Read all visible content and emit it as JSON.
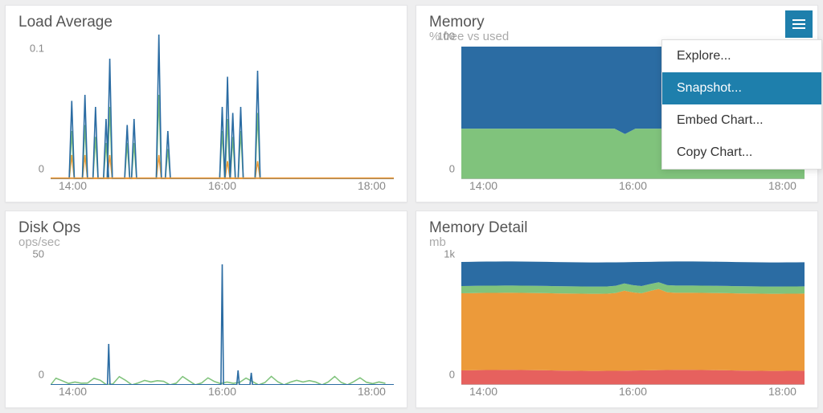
{
  "colors": {
    "blue": "#2b6ca3",
    "green": "#80c37c",
    "orange": "#ec9a3a",
    "red": "#e6615e",
    "accent": "#1e7fac"
  },
  "menu": {
    "items": [
      "Explore...",
      "Snapshot...",
      "Embed Chart...",
      "Copy Chart..."
    ],
    "selected_index": 1
  },
  "cards": {
    "load": {
      "title": "Load Average",
      "sub": "",
      "xticks": [
        "14:00",
        "16:00",
        "18:00"
      ],
      "yticks": [
        {
          "v": 0,
          "label": "0"
        },
        {
          "v": 0.1,
          "label": "0.1"
        }
      ]
    },
    "memory": {
      "title": "Memory",
      "sub": "% free vs used",
      "xticks": [
        "14:00",
        "16:00",
        "18:00"
      ],
      "yticks": [
        {
          "v": 0,
          "label": "0"
        },
        {
          "v": 100,
          "label": "100"
        }
      ]
    },
    "diskops": {
      "title": "Disk Ops",
      "sub": "ops/sec",
      "xticks": [
        "14:00",
        "16:00",
        "18:00"
      ],
      "yticks": [
        {
          "v": 0,
          "label": "0"
        },
        {
          "v": 50,
          "label": "50"
        }
      ]
    },
    "memdetail": {
      "title": "Memory Detail",
      "sub": "mb",
      "xticks": [
        "14:00",
        "16:00",
        "18:00"
      ],
      "yticks": [
        {
          "v": 0,
          "label": "0"
        },
        {
          "v": 1000,
          "label": "1k"
        }
      ]
    }
  },
  "chart_data": [
    {
      "id": "load",
      "type": "line",
      "title": "Load Average",
      "xlabel": "",
      "ylabel": "",
      "ylim": [
        0,
        0.12
      ],
      "x_range_hours": [
        12.5,
        19
      ],
      "series": [
        {
          "name": "load-blue",
          "color": "#2b6ca3",
          "spikes": [
            {
              "x": 12.9,
              "y": 0.065
            },
            {
              "x": 13.15,
              "y": 0.07
            },
            {
              "x": 13.35,
              "y": 0.06
            },
            {
              "x": 13.55,
              "y": 0.05
            },
            {
              "x": 13.62,
              "y": 0.1
            },
            {
              "x": 13.95,
              "y": 0.045
            },
            {
              "x": 14.08,
              "y": 0.05
            },
            {
              "x": 14.55,
              "y": 0.12
            },
            {
              "x": 14.72,
              "y": 0.04
            },
            {
              "x": 15.75,
              "y": 0.06
            },
            {
              "x": 15.85,
              "y": 0.085
            },
            {
              "x": 15.95,
              "y": 0.055
            },
            {
              "x": 16.1,
              "y": 0.06
            },
            {
              "x": 16.42,
              "y": 0.09
            }
          ]
        },
        {
          "name": "load-green",
          "color": "#80c37c",
          "spikes": [
            {
              "x": 12.9,
              "y": 0.04
            },
            {
              "x": 13.15,
              "y": 0.045
            },
            {
              "x": 13.35,
              "y": 0.035
            },
            {
              "x": 13.55,
              "y": 0.03
            },
            {
              "x": 13.62,
              "y": 0.06
            },
            {
              "x": 13.95,
              "y": 0.03
            },
            {
              "x": 14.08,
              "y": 0.03
            },
            {
              "x": 14.55,
              "y": 0.07
            },
            {
              "x": 14.72,
              "y": 0.025
            },
            {
              "x": 15.75,
              "y": 0.04
            },
            {
              "x": 15.85,
              "y": 0.05
            },
            {
              "x": 15.95,
              "y": 0.035
            },
            {
              "x": 16.1,
              "y": 0.04
            },
            {
              "x": 16.42,
              "y": 0.055
            }
          ]
        },
        {
          "name": "load-orange",
          "color": "#ec9a3a",
          "spikes": [
            {
              "x": 12.9,
              "y": 0.02
            },
            {
              "x": 13.15,
              "y": 0.02
            },
            {
              "x": 13.62,
              "y": 0.02
            },
            {
              "x": 14.55,
              "y": 0.02
            },
            {
              "x": 15.85,
              "y": 0.015
            },
            {
              "x": 16.42,
              "y": 0.015
            }
          ]
        }
      ]
    },
    {
      "id": "memory",
      "type": "area",
      "title": "Memory",
      "subtitle": "% free vs used",
      "ylim": [
        0,
        100
      ],
      "x_range_hours": [
        12.5,
        19
      ],
      "stack": [
        {
          "name": "free",
          "color": "#80c37c",
          "level": 38
        },
        {
          "name": "used",
          "color": "#2b6ca3",
          "level": 100
        }
      ],
      "wobble_x": 15.6
    },
    {
      "id": "diskops",
      "type": "line",
      "title": "Disk Ops",
      "subtitle": "ops/sec",
      "ylim": [
        0,
        55
      ],
      "x_range_hours": [
        12.5,
        19
      ],
      "series": [
        {
          "name": "disk-blue",
          "color": "#2b6ca3",
          "spikes": [
            {
              "x": 13.6,
              "y": 17
            },
            {
              "x": 15.75,
              "y": 50
            },
            {
              "x": 16.05,
              "y": 6
            },
            {
              "x": 16.3,
              "y": 5
            }
          ]
        },
        {
          "name": "disk-green",
          "color": "#80c37c",
          "noise": {
            "amp": 4,
            "from": 12.6,
            "to": 18.9
          }
        }
      ]
    },
    {
      "id": "memdetail",
      "type": "area",
      "title": "Memory Detail",
      "subtitle": "mb",
      "ylim": [
        0,
        1100
      ],
      "x_range_hours": [
        12.5,
        19
      ],
      "stack": [
        {
          "name": "red",
          "color": "#e6615e",
          "level": 120
        },
        {
          "name": "orange",
          "color": "#ec9a3a",
          "level": 760,
          "bumps": [
            {
              "x": 15.6,
              "d": 25
            },
            {
              "x": 16.2,
              "d": 40
            }
          ]
        },
        {
          "name": "green",
          "color": "#80c37c",
          "level": 820,
          "bumps": [
            {
              "x": 15.6,
              "d": 25
            },
            {
              "x": 16.2,
              "d": 35
            }
          ]
        },
        {
          "name": "blue",
          "color": "#2b6ca3",
          "level": 1020
        }
      ]
    }
  ]
}
